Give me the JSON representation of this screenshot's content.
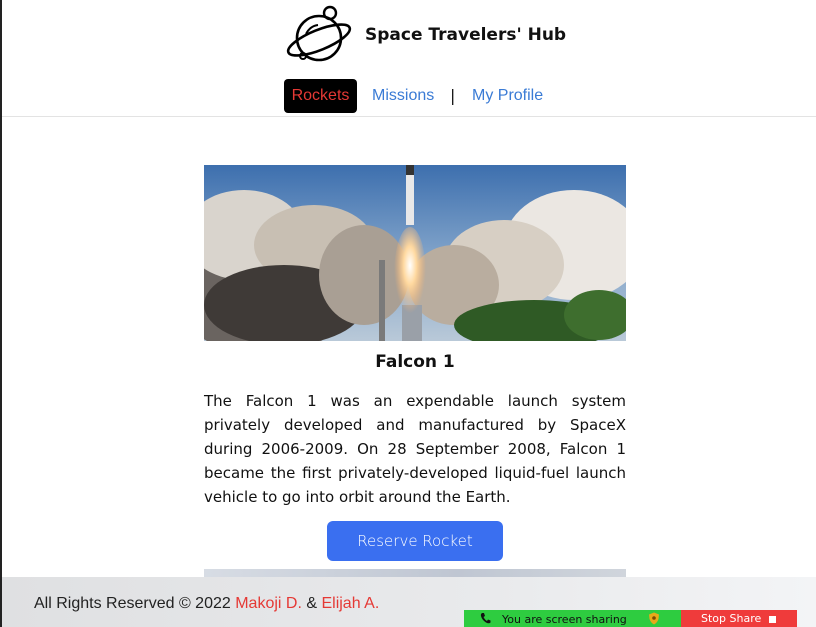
{
  "header": {
    "brand": "Space Travelers' Hub",
    "nav": {
      "rockets": "Rockets",
      "missions": "Missions",
      "separator": "|",
      "profile": "My Profile"
    }
  },
  "rocket": {
    "name": "Falcon 1",
    "description": "The Falcon 1 was an expendable launch system privately developed and manufactured by SpaceX during 2006-2009. On 28 September 2008, Falcon 1 became the first privately-developed liquid-fuel launch vehicle to go into orbit around the Earth.",
    "button": "Reserve Rocket"
  },
  "footer": {
    "prefix": "All Rights Reserved © 2022 ",
    "author1": "Makoji D.",
    "joiner": " & ",
    "author2": "Elijah A."
  },
  "screen_share": {
    "message": "You are screen sharing",
    "stop": "Stop Share"
  },
  "colors": {
    "accent_blue": "#3a6ff0",
    "nav_link": "#3a7bd5",
    "active_red": "#e53935",
    "share_green": "#2ecc40",
    "stop_red": "#ef3b3b"
  },
  "icons": {
    "logo": "planet-icon",
    "phone": "phone-icon",
    "shield": "shield-icon",
    "stop": "stop-square-icon"
  }
}
